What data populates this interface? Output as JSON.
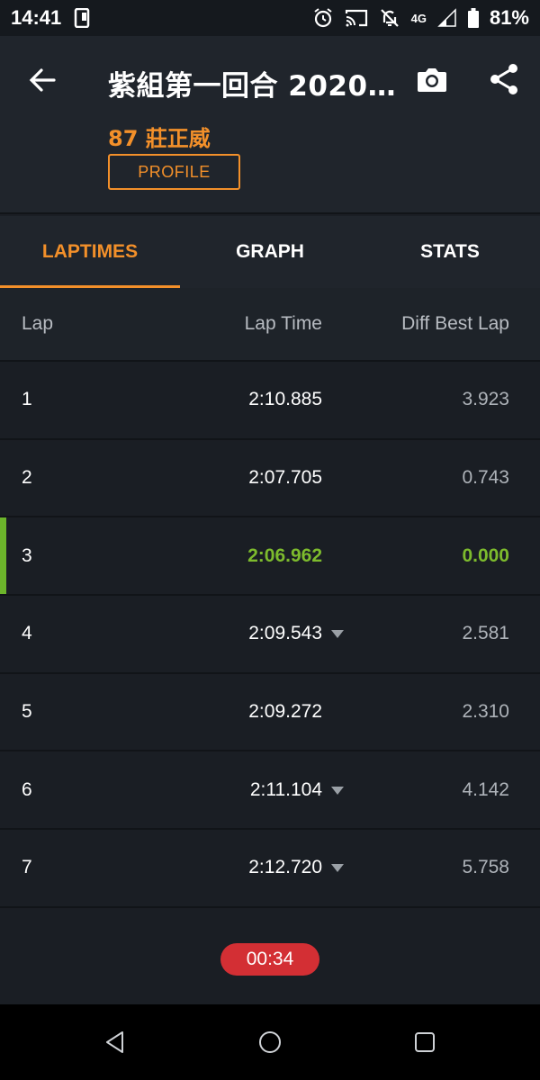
{
  "status_bar": {
    "time": "14:41",
    "network": "4G",
    "battery": "81%"
  },
  "header": {
    "title": "紫組第一回合 2020...",
    "driver": "87 莊正威",
    "profile_label": "PROFILE"
  },
  "tabs": [
    {
      "label": "LAPTIMES",
      "active": true
    },
    {
      "label": "GRAPH",
      "active": false
    },
    {
      "label": "STATS",
      "active": false
    }
  ],
  "table": {
    "headers": {
      "lap": "Lap",
      "lap_time": "Lap Time",
      "diff": "Diff Best Lap"
    },
    "rows": [
      {
        "lap": "1",
        "time": "2:10.885",
        "diff": "3.923",
        "slower": false,
        "best": false
      },
      {
        "lap": "2",
        "time": "2:07.705",
        "diff": "0.743",
        "slower": false,
        "best": false
      },
      {
        "lap": "3",
        "time": "2:06.962",
        "diff": "0.000",
        "slower": false,
        "best": true
      },
      {
        "lap": "4",
        "time": "2:09.543",
        "diff": "2.581",
        "slower": true,
        "best": false
      },
      {
        "lap": "5",
        "time": "2:09.272",
        "diff": "2.310",
        "slower": false,
        "best": false
      },
      {
        "lap": "6",
        "time": "2:11.104",
        "diff": "4.142",
        "slower": true,
        "best": false
      },
      {
        "lap": "7",
        "time": "2:12.720",
        "diff": "5.758",
        "slower": true,
        "best": false
      }
    ]
  },
  "timer": "00:34",
  "colors": {
    "accent": "#f3902a",
    "best": "#7dbb2d",
    "timer": "#d32f34",
    "background": "#1a1e24"
  },
  "icons": {
    "back": "arrow-left-icon",
    "camera": "camera-icon",
    "share": "share-icon",
    "slower": "triangle-down-icon"
  }
}
